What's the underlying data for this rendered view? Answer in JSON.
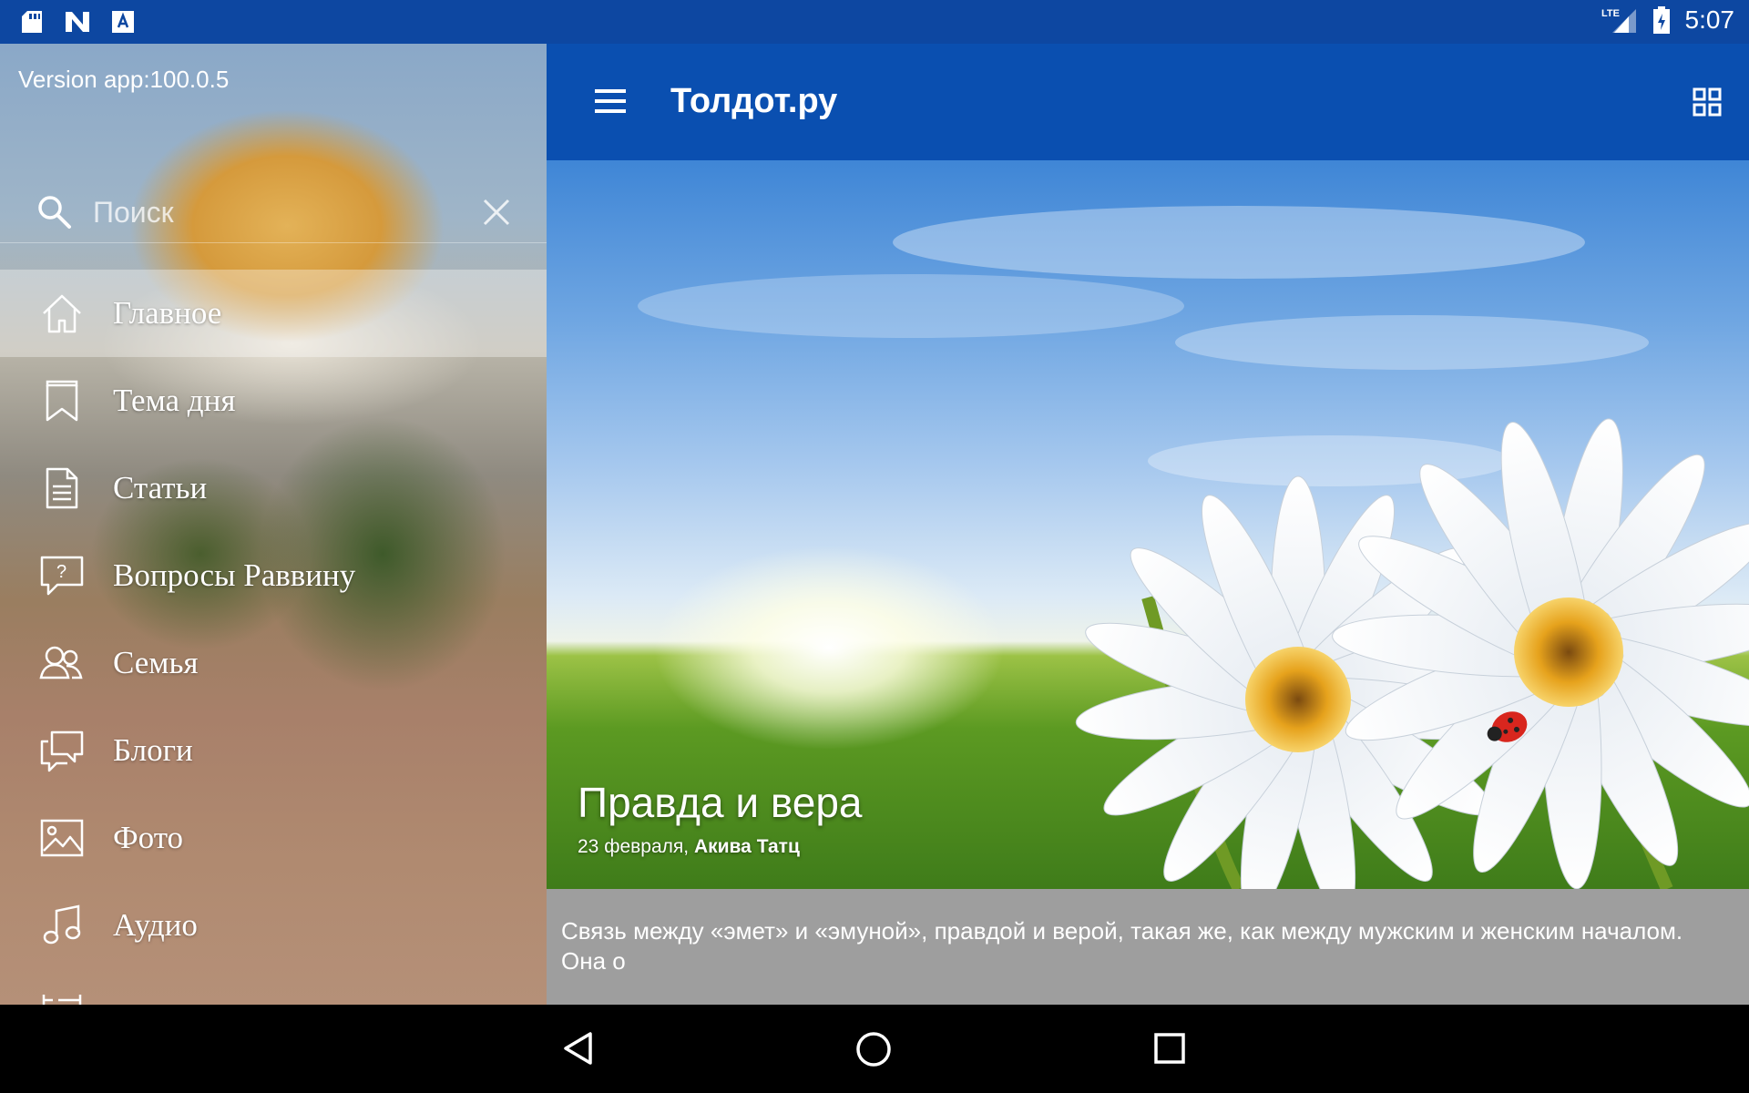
{
  "status_bar": {
    "time": "5:07",
    "network": "LTE",
    "left_icons": [
      "sd-card-icon",
      "n-icon",
      "a-icon"
    ]
  },
  "drawer": {
    "version": "Version app:100.0.5",
    "search": {
      "placeholder": "Поиск",
      "value": ""
    },
    "items": [
      {
        "label": "Главное",
        "icon": "home-icon",
        "active": true
      },
      {
        "label": "Тема дня",
        "icon": "bookmark-icon"
      },
      {
        "label": "Статьи",
        "icon": "document-icon"
      },
      {
        "label": "Вопросы Раввину",
        "icon": "question-bubble-icon"
      },
      {
        "label": "Семья",
        "icon": "family-icon"
      },
      {
        "label": "Блоги",
        "icon": "chat-bubbles-icon"
      },
      {
        "label": "Фото",
        "icon": "image-icon"
      },
      {
        "label": "Аудио",
        "icon": "music-note-icon"
      }
    ]
  },
  "app_bar": {
    "title": "Толдот.ру"
  },
  "article": {
    "title": "Правда и вера",
    "date": "23 февраля,",
    "author": "Акива Татц",
    "excerpt": "Связь между «эмет» и «эмуной», правдой и верой, такая же, как между мужским и женским началом. Она о"
  },
  "colors": {
    "status_bar": "#0d47a1",
    "app_bar": "#0a4fb0",
    "excerpt_bg": "#9e9e9e"
  }
}
